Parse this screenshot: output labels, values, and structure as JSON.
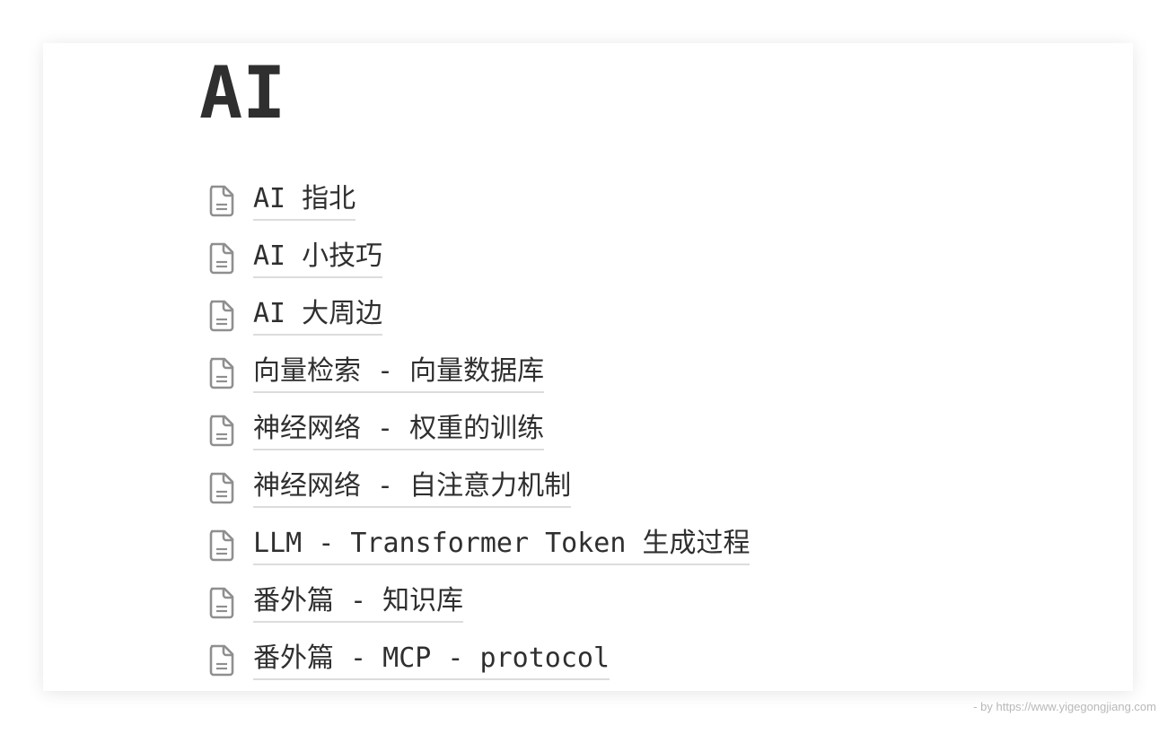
{
  "page": {
    "title": "AI"
  },
  "items": [
    {
      "label": "AI 指北",
      "icon": "document-icon"
    },
    {
      "label": "AI 小技巧",
      "icon": "document-icon"
    },
    {
      "label": "AI 大周边",
      "icon": "document-icon"
    },
    {
      "label": "向量检索 - 向量数据库",
      "icon": "document-icon"
    },
    {
      "label": "神经网络 - 权重的训练",
      "icon": "document-icon"
    },
    {
      "label": "神经网络 - 自注意力机制",
      "icon": "document-icon"
    },
    {
      "label": "LLM - Transformer Token 生成过程",
      "icon": "document-icon"
    },
    {
      "label": "番外篇 - 知识库",
      "icon": "document-icon"
    },
    {
      "label": "番外篇 - MCP - protocol",
      "icon": "document-icon"
    }
  ],
  "footer": {
    "text": "- by https://www.yigegongjiang.com"
  }
}
